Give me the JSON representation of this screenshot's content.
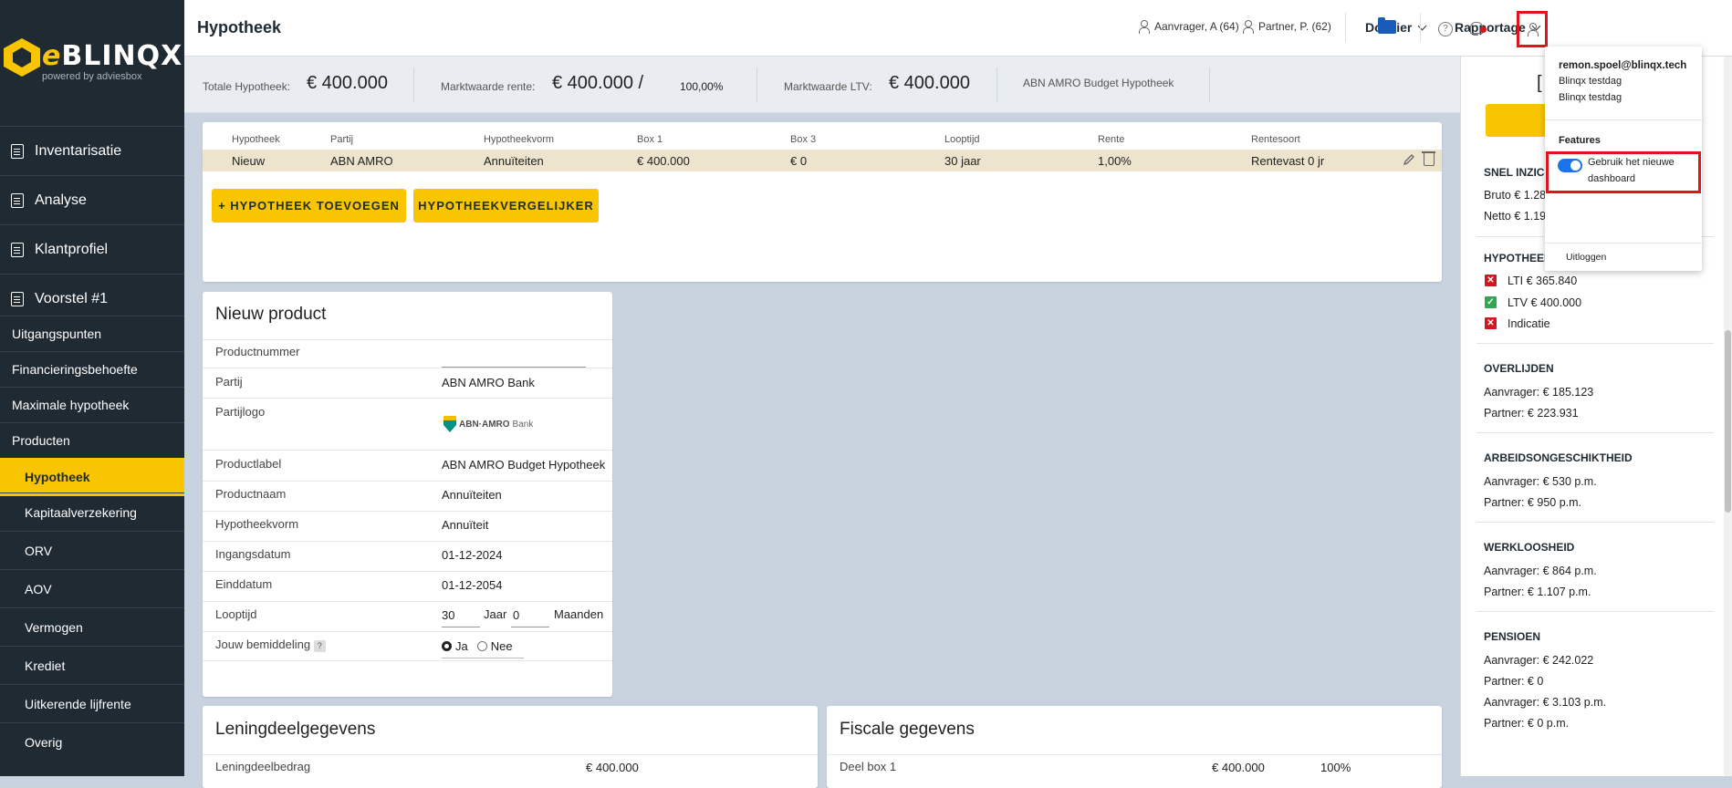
{
  "app": {
    "logo_text": "BLINQX",
    "logo_letter": "e",
    "powered_by": "powered by adviesbox"
  },
  "sidebar": {
    "sections": [
      {
        "label": "Inventarisatie"
      },
      {
        "label": "Analyse"
      },
      {
        "label": "Klantprofiel"
      },
      {
        "label": "Voorstel #1"
      }
    ],
    "items": [
      {
        "label": "Uitgangspunten"
      },
      {
        "label": "Financieringsbehoefte"
      },
      {
        "label": "Maximale hypotheek"
      },
      {
        "label": "Producten"
      }
    ],
    "subitems": [
      {
        "label": "Hypotheek",
        "active": true
      },
      {
        "label": "Kapitaalverzekering"
      },
      {
        "label": "ORV"
      },
      {
        "label": "AOV"
      },
      {
        "label": "Vermogen"
      },
      {
        "label": "Krediet"
      },
      {
        "label": "Uitkerende lijfrente"
      },
      {
        "label": "Overig"
      }
    ]
  },
  "header": {
    "title": "Hypotheek",
    "applicant": "Aanvrager, A (64)",
    "partner": "Partner, P. (62)",
    "menu_dossier": "Dossier",
    "menu_rapportage": "Rapportage",
    "help_symbol": "?"
  },
  "summary": {
    "totale_label": "Totale Hypotheek:",
    "totale_value": "€ 400.000",
    "marktwaarde_rente_label": "Marktwaarde rente:",
    "marktwaarde_rente_value": "€ 400.000 /",
    "percentage": "100,00%",
    "ltv_label": "Marktwaarde LTV:",
    "ltv_value": "€ 400.000",
    "product_name": "ABN AMRO Budget Hypotheek"
  },
  "table": {
    "headers": [
      "Hypotheek",
      "Partij",
      "Hypotheekvorm",
      "Box 1",
      "Box 3",
      "Looptijd",
      "Rente",
      "Rentesoort"
    ],
    "row": [
      "Nieuw",
      "ABN AMRO",
      "Annuïteiten",
      "€ 400.000",
      "€ 0",
      "30 jaar",
      "1,00%",
      "Rentevast 0 jr"
    ],
    "add_button": "+ HYPOTHEEK TOEVOEGEN",
    "compare_button": "HYPOTHEEKVERGELIJKER"
  },
  "nieuw_product": {
    "title": "Nieuw product",
    "fields": [
      {
        "label": "Productnummer",
        "value": ""
      },
      {
        "label": "Partij",
        "value": "ABN AMRO Bank"
      },
      {
        "label": "Partijlogo",
        "value": ""
      },
      {
        "label": "Productlabel",
        "value": "ABN AMRO Budget Hypotheek"
      },
      {
        "label": "Productnaam",
        "value": "Annuïteiten"
      },
      {
        "label": "Hypotheekvorm",
        "value": "Annuïteit"
      },
      {
        "label": "Ingangsdatum",
        "value": "01-12-2024"
      },
      {
        "label": "Einddatum",
        "value": "01-12-2054"
      },
      {
        "label": "Looptijd",
        "value": ""
      },
      {
        "label": "Jouw bemiddeling",
        "value": ""
      }
    ],
    "partij_logo_text": "ABN·AMRO",
    "partij_logo_sub": "Bank",
    "looptijd_jaar_value": "30",
    "looptijd_jaar_label": "Jaar",
    "looptijd_maanden_value": "0",
    "looptijd_maanden_label": "Maanden",
    "bemiddeling_help": "?",
    "radio_ja": "Ja",
    "radio_nee": "Nee"
  },
  "leningdeel": {
    "title": "Leningdeelgegevens",
    "row_label": "Leningdeelbedrag",
    "row_value": "€ 400.000"
  },
  "fiscaal": {
    "title": "Fiscale gegevens",
    "row_label": "Deel box 1",
    "row_value": "€ 400.000",
    "row_pct": "100%"
  },
  "right_panel": {
    "partial_title": "[",
    "snel_inzicht": "SNEL INZICH",
    "bruto": "Bruto € 1.28",
    "netto": "Netto € 1.19",
    "hypotheek_head": "HYPOTHEEK",
    "lti": "LTI € 365.840",
    "ltv": "LTV € 400.000",
    "indicatie": "Indicatie",
    "overlijden_head": "OVERLIJDEN",
    "overlijden_aanvrager": "Aanvrager: € 185.123",
    "overlijden_partner": "Partner: € 223.931",
    "ao_head": "ARBEIDSONGESCHIKTHEID",
    "ao_aanvrager": "Aanvrager: € 530 p.m.",
    "ao_partner": "Partner: € 950 p.m.",
    "ww_head": "WERKLOOSHEID",
    "ww_aanvrager": "Aanvrager: € 864 p.m.",
    "ww_partner": "Partner: € 1.107 p.m.",
    "pensioen_head": "PENSIOEN",
    "pensioen_aanvrager": "Aanvrager: € 242.022",
    "pensioen_partner": "Partner: € 0",
    "pensioen_aanvrager_pm": "Aanvrager: € 3.103 p.m.",
    "pensioen_partner_pm": "Partner: € 0 p.m.",
    "cross_symbol": "✕",
    "check_symbol": "✓"
  },
  "user_menu": {
    "email": "remon.spoel@blinqx.tech",
    "org1": "Blinqx testdag",
    "org2": "Blinqx testdag",
    "features_label": "Features",
    "toggle_label_1": "Gebruik het nieuwe",
    "toggle_label_2": "dashboard",
    "toggle_on": true,
    "logout": "Uitloggen"
  },
  "colors": {
    "accent": "#f8c500",
    "sidebar": "#1f2a33",
    "highlight": "#e2141b",
    "toggle": "#1a73e8"
  }
}
